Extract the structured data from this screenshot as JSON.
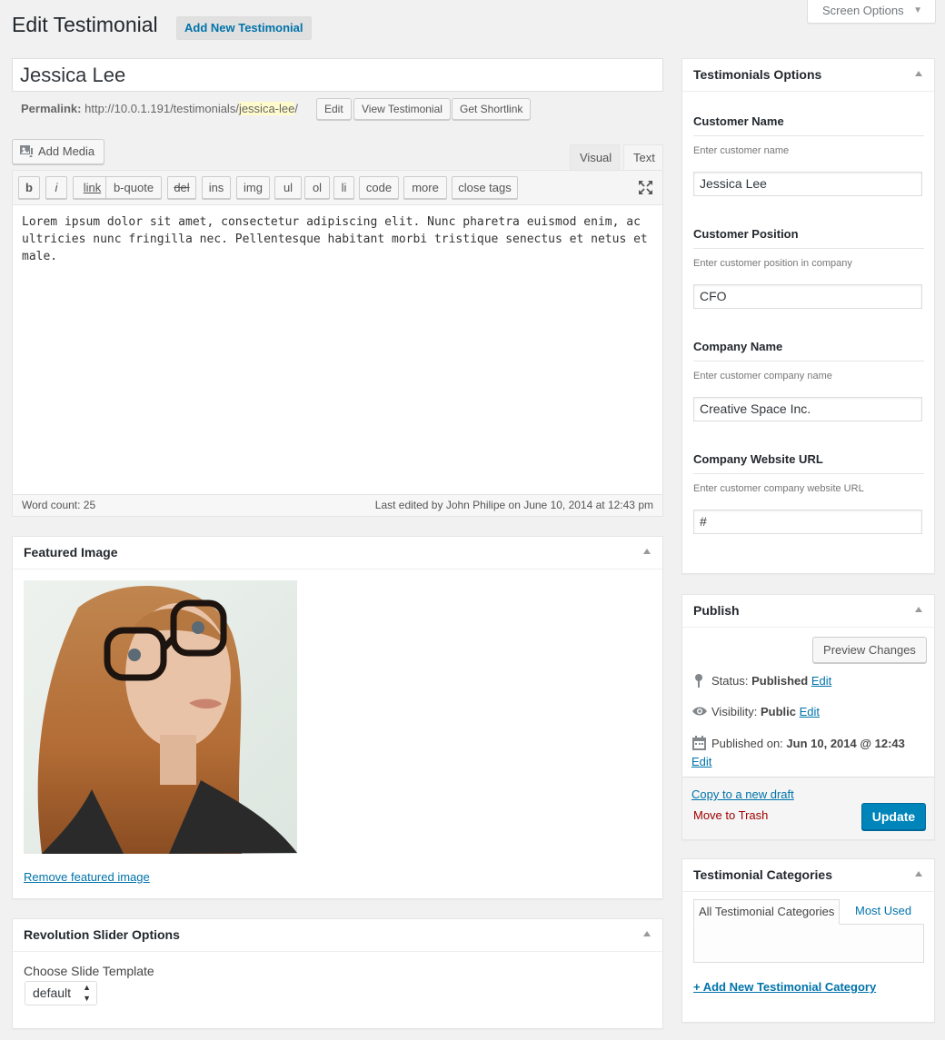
{
  "header": {
    "title": "Edit Testimonial",
    "add_new_label": "Add New Testimonial",
    "screen_options_label": "Screen Options"
  },
  "post": {
    "title": "Jessica Lee",
    "permalink_label": "Permalink:",
    "permalink_base": "http://10.0.1.191/testimonials/",
    "permalink_slug": "jessica-lee",
    "permalink_trailing": "/",
    "edit_label": "Edit",
    "view_label": "View Testimonial",
    "shortlink_label": "Get Shortlink"
  },
  "editor": {
    "add_media_label": "Add Media",
    "tabs": [
      "Visual",
      "Text"
    ],
    "active_tab": "Text",
    "quicktags": [
      "b",
      "i",
      "link",
      "b-quote",
      "del",
      "ins",
      "img",
      "ul",
      "ol",
      "li",
      "code",
      "more",
      "close tags"
    ],
    "content": "Lorem ipsum dolor sit amet, consectetur adipiscing elit. Nunc pharetra euismod enim, ac\nultricies nunc fringilla nec. Pellentesque habitant morbi tristique senectus et netus et\nmale.",
    "word_count": "Word count: 25",
    "last_edited": "Last edited by John Philipe on June 10, 2014 at 12:43 pm"
  },
  "featured_image": {
    "title": "Featured Image",
    "remove_label": "Remove featured image"
  },
  "revolution_slider": {
    "title": "Revolution Slider Options",
    "template_label": "Choose Slide Template",
    "template_value": "default"
  },
  "testimonial_options": {
    "title": "Testimonials Options",
    "fields": [
      {
        "label": "Customer Name",
        "help": "Enter customer name",
        "value": "Jessica Lee"
      },
      {
        "label": "Customer Position",
        "help": "Enter customer position in company",
        "value": "CFO"
      },
      {
        "label": "Company Name",
        "help": "Enter customer company name",
        "value": "Creative Space Inc."
      },
      {
        "label": "Company Website URL",
        "help": "Enter customer company website URL",
        "value": "#"
      }
    ]
  },
  "publish": {
    "title": "Publish",
    "preview_label": "Preview Changes",
    "status_label": "Status:",
    "status_value": "Published",
    "visibility_label": "Visibility:",
    "visibility_value": "Public",
    "published_label": "Published on:",
    "published_value": "Jun 10, 2014 @ 12:43",
    "edit_link": "Edit",
    "copy_draft_label": "Copy to a new draft",
    "trash_label": "Move to Trash",
    "update_label": "Update"
  },
  "categories": {
    "title": "Testimonial Categories",
    "tab_all": "All Testimonial Categories",
    "tab_most_used": "Most Used",
    "add_new_label": "+ Add New Testimonial Category"
  },
  "colors": {
    "accent": "#0073aa",
    "primary_button": "#0085ba",
    "trash": "#a00000",
    "background": "#f1f1f1"
  }
}
